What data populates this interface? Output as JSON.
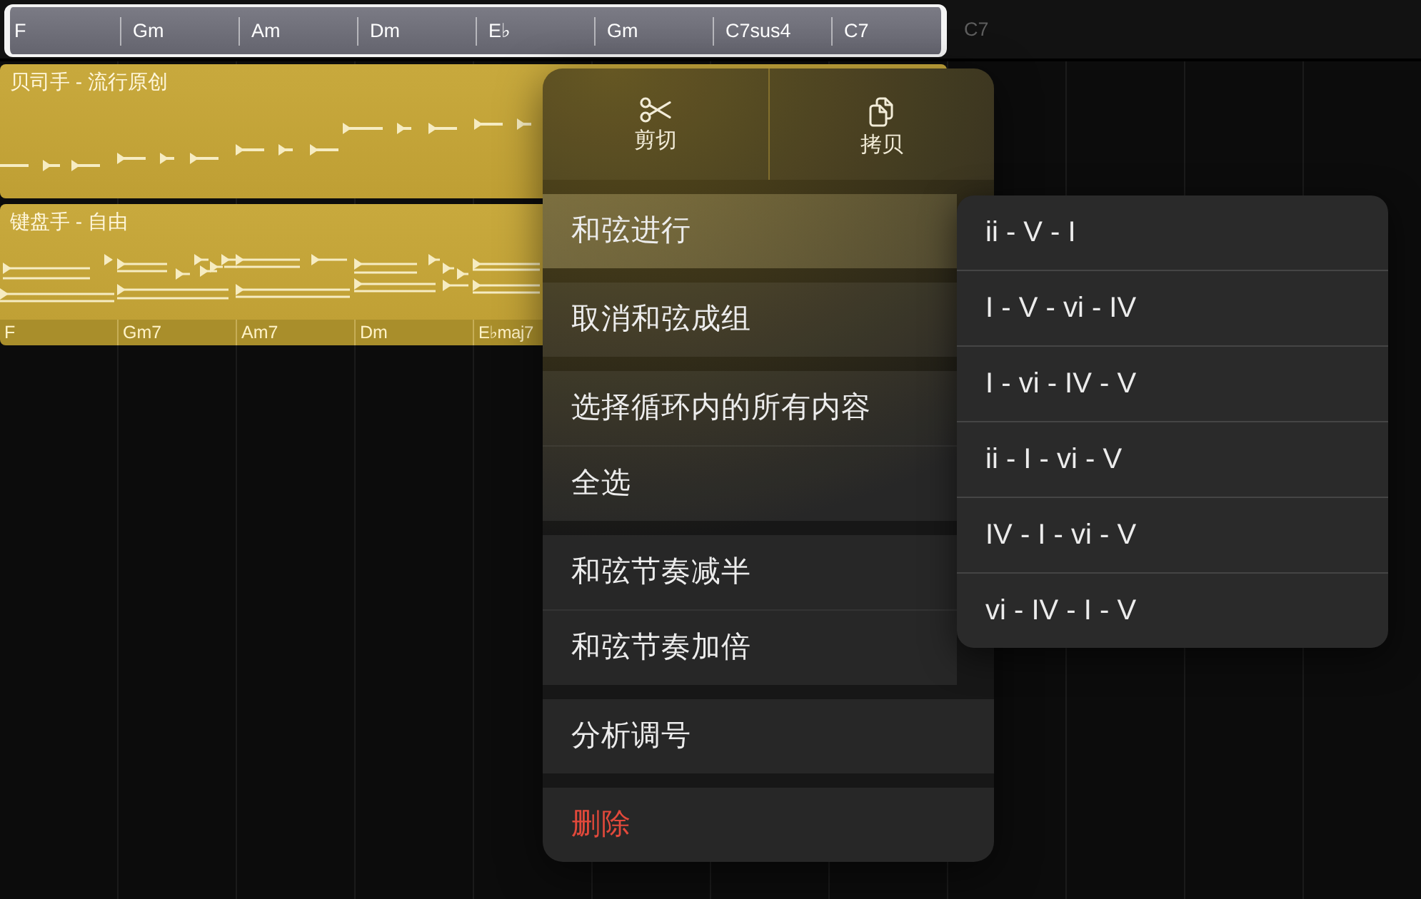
{
  "chord_track": {
    "chords": [
      {
        "label": "F",
        "selected": true
      },
      {
        "label": "Gm",
        "selected": true
      },
      {
        "label": "Am",
        "selected": true
      },
      {
        "label": "Dm",
        "selected": true
      },
      {
        "label": "E♭",
        "selected": true
      },
      {
        "label": "Gm",
        "selected": true
      },
      {
        "label": "C7sus4",
        "selected": true
      },
      {
        "label": "C7",
        "selected": true
      },
      {
        "label": "C7",
        "selected": false
      }
    ]
  },
  "tracks": [
    {
      "title": "贝司手 - 流行原创",
      "kind": "bass"
    },
    {
      "title": "键盘手 - 自由",
      "kind": "keyboard",
      "chords": [
        "F",
        "Gm7",
        "Am7",
        "Dm",
        "E♭maj7"
      ]
    }
  ],
  "context_menu": {
    "actions": [
      {
        "kind": "cut",
        "label": "剪切"
      },
      {
        "kind": "copy",
        "label": "拷贝"
      }
    ],
    "groups": [
      {
        "items": [
          {
            "label": "和弦进行",
            "selected": true,
            "destructive": false
          }
        ]
      },
      {
        "items": [
          {
            "label": "取消和弦成组",
            "selected": false,
            "destructive": false
          }
        ]
      },
      {
        "items": [
          {
            "label": "选择循环内的所有内容",
            "selected": false,
            "destructive": false
          },
          {
            "label": "全选",
            "selected": false,
            "destructive": false
          }
        ]
      },
      {
        "items": [
          {
            "label": "和弦节奏减半",
            "selected": false,
            "destructive": false
          },
          {
            "label": "和弦节奏加倍",
            "selected": false,
            "destructive": false
          }
        ]
      },
      {
        "items": [
          {
            "label": "分析调号",
            "selected": false,
            "destructive": false
          }
        ]
      },
      {
        "items": [
          {
            "label": "删除",
            "selected": false,
            "destructive": true
          }
        ]
      }
    ]
  },
  "submenu": {
    "items": [
      {
        "label": "ii - V - I"
      },
      {
        "label": "I - V - vi - IV"
      },
      {
        "label": "I - vi - IV - V"
      },
      {
        "label": "ii - I - vi - V"
      },
      {
        "label": "IV - I - vi - V"
      },
      {
        "label": "vi - IV - I - V"
      }
    ]
  }
}
